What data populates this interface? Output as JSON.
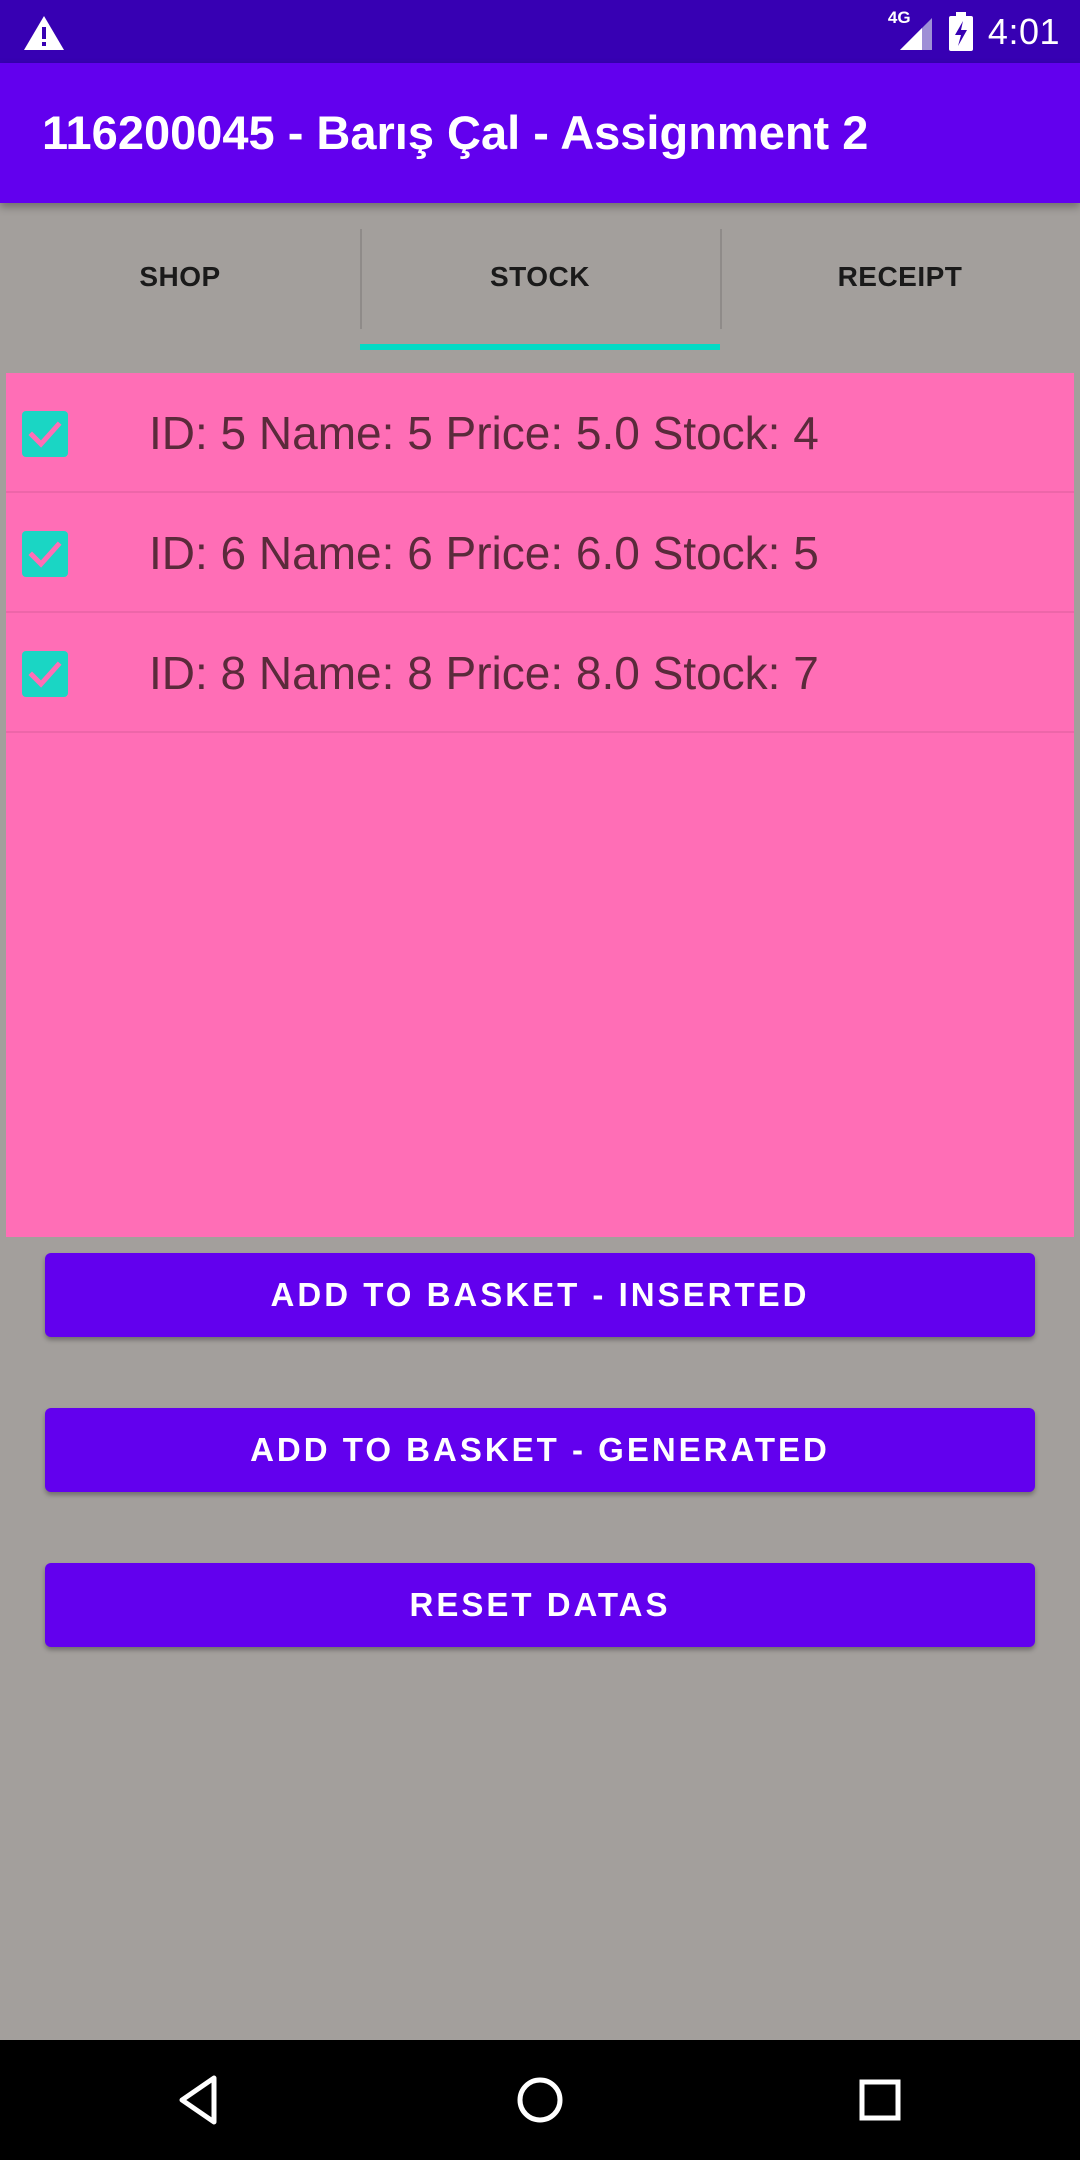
{
  "status_bar": {
    "alert_icon": "warning-icon",
    "network_type": "4G",
    "signal_icon": "signal-icon",
    "battery_icon": "battery-charging-icon",
    "time": "4:01"
  },
  "app_bar": {
    "title": "116200045 - Barış Çal - Assignment 2"
  },
  "tabs": [
    {
      "label": "SHOP",
      "active": false
    },
    {
      "label": "STOCK",
      "active": true
    },
    {
      "label": "RECEIPT",
      "active": false
    }
  ],
  "stock_list": [
    {
      "checked": true,
      "text": "ID: 5 Name: 5 Price: 5.0 Stock: 4"
    },
    {
      "checked": true,
      "text": "ID: 6 Name: 6 Price: 6.0 Stock: 5"
    },
    {
      "checked": true,
      "text": "ID: 8 Name: 8 Price: 8.0 Stock: 7"
    }
  ],
  "buttons": {
    "add_inserted": "ADD TO BASKET - INSERTED",
    "add_generated": "ADD TO BASKET - GENERATED",
    "reset": "RESET DATAS"
  },
  "nav_bar": {
    "back_icon": "back-icon",
    "home_icon": "home-icon",
    "recents_icon": "recents-icon"
  },
  "colors": {
    "status_bar": "#3700b3",
    "primary": "#6200ee",
    "accent": "#03dac5",
    "list_background": "#ff6eb6",
    "page_background": "#a39f9c"
  }
}
